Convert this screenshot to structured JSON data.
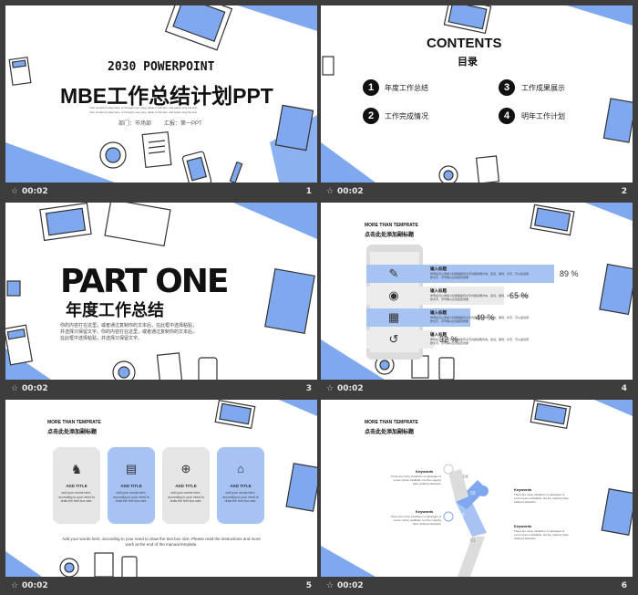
{
  "slides": [
    {
      "index": "1",
      "time": "00:02",
      "kicker": "2030 POWERPOINT",
      "title": "MBE工作总结计划PPT",
      "blurb_line1": "Your content to play here, or through your copy, paste in this box, and select only the text",
      "blurb_line2": "Your content to play here, or through your copy, paste in this box, and select only the text",
      "dept": "部门：市场部",
      "reporter": "汇报：第一PPT"
    },
    {
      "index": "2",
      "time": "00:02",
      "title_en": "CONTENTS",
      "title_cn": "目录",
      "items": [
        {
          "num": "1",
          "label": "年度工作总结"
        },
        {
          "num": "2",
          "label": "工作完成情况"
        },
        {
          "num": "3",
          "label": "工作成果展示"
        },
        {
          "num": "4",
          "label": "明年工作计划"
        }
      ]
    },
    {
      "index": "3",
      "time": "00:02",
      "title": "PART ONE",
      "subtitle": "年度工作总结",
      "body": "你的内容打在这里，或者通过复制你的文本后，在此框中选择粘贴，并选择只保留文字。你的内容打在这里，或者通过复制你的文本后，在此框中选择粘贴，并选择只保留文字。"
    },
    {
      "index": "4",
      "time": "00:02",
      "kicker": "MORE THAN TEMPRATE",
      "heading": "点击此处添加副标题",
      "rows": [
        {
          "title": "输入标题",
          "desc": "你现在可以添加小标题描述有文字内容说明方向，适当，保持，文字，可以适当调整文字，字号等以达到最佳效果",
          "value": 89,
          "pct": "89 %",
          "icon": "pencil-icon"
        },
        {
          "title": "输入标题",
          "desc": "你现在可以添加小标题描述有文字内容说明方向，适当，保持，文字，可以适当调整文字，字号等以达到最佳效果",
          "value": 65,
          "pct": "65 %",
          "icon": "palette-icon"
        },
        {
          "title": "输入标题",
          "desc": "你现在可以添加小标题描述有文字内容说明方向，适当，保持，文字，可以适当调整文字，字号等以达到最佳效果",
          "value": 49,
          "pct": "49 %",
          "icon": "store-icon"
        },
        {
          "title": "输入标题",
          "desc": "你现在可以添加小标题描述有文字内容说明方向，适当，保持，文字，可以适当调整文字，字号等以达到最佳效果",
          "value": 32,
          "pct": "32 %",
          "icon": "history-icon"
        }
      ]
    },
    {
      "index": "5",
      "time": "00:02",
      "kicker": "MORE THAN TEMPRATE",
      "heading": "点击此处添加副标题",
      "cards": [
        {
          "title": "ADD TITLE",
          "desc": "add your words here, according to your need to draw the text box size.",
          "icon": "chess-icon"
        },
        {
          "title": "ADD TITLE",
          "desc": "add your words here, according to your need to draw the text box size.",
          "icon": "document-chart-icon"
        },
        {
          "title": "ADD TITLE",
          "desc": "add your words here, according to your need to draw the text box size.",
          "icon": "globe-icon"
        },
        {
          "title": "ADD TITLE",
          "desc": "add your words here, according to your need to draw the text box size.",
          "icon": "house-icon"
        }
      ],
      "footer_note": "Add your words here, according to your need to draw the text box size, Please read the instructions and more work at the end of the manual template."
    },
    {
      "index": "6",
      "time": "00:02",
      "kicker": "MORE THAN TEMPRATE",
      "heading": "点击此处添加副标题",
      "steps": [
        {
          "label": "Keywords",
          "text": "There are many variations of passages of Lorem Ipsum available, but the majority have suffered alteration",
          "step": "04"
        },
        {
          "label": "Keywords",
          "text": "There are many variations of passages of Lorem Ipsum available, but the majority have suffered alteration",
          "step": "03"
        },
        {
          "label": "Keywords",
          "text": "There are many variations of passages of Lorem Ipsum available, but the majority have suffered alteration",
          "step": "02"
        },
        {
          "label": "Keywords",
          "text": "There are many variations of passages of Lorem Ipsum available, but the majority have suffered alteration",
          "step": "01"
        }
      ]
    }
  ],
  "colors": {
    "accent": "#7fa8ef",
    "dark": "#111111",
    "footer": "#3d3d3d",
    "card_gray": "#e6e6e6"
  }
}
